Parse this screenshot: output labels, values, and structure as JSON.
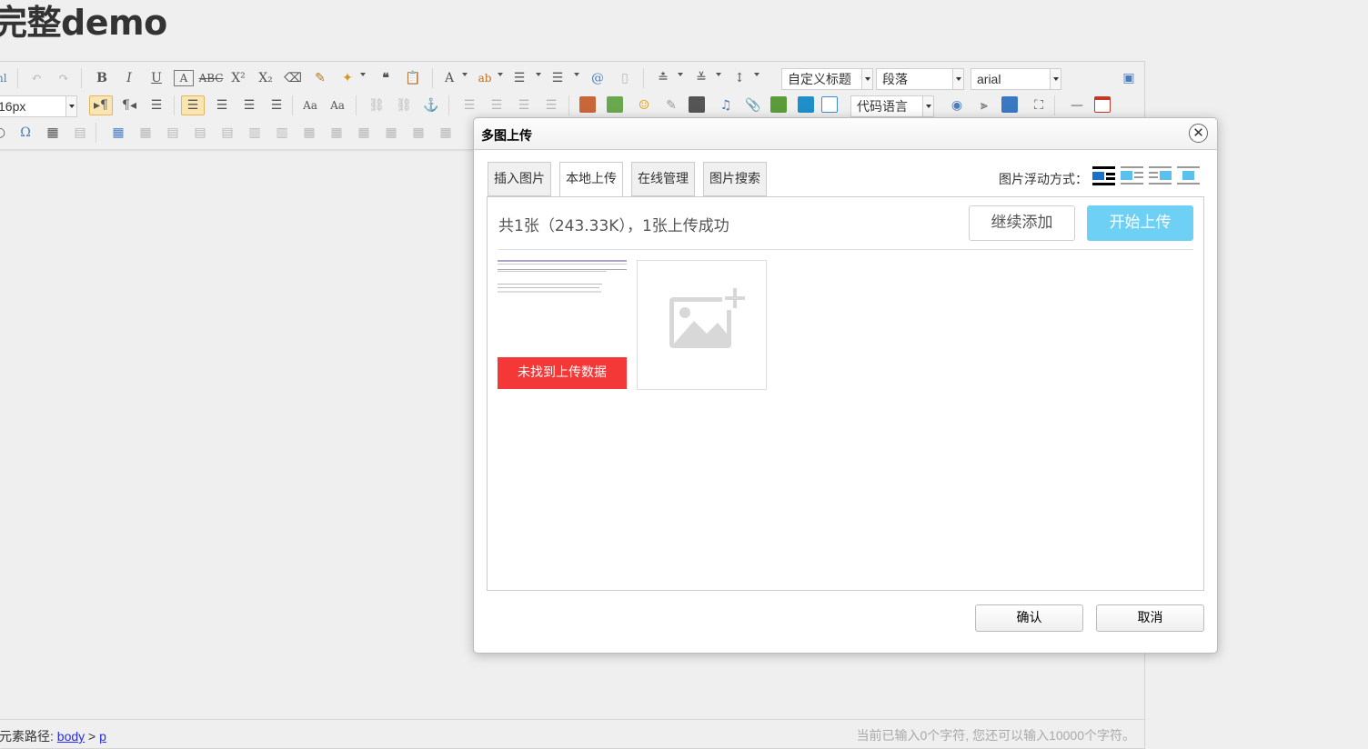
{
  "page": {
    "title": "完整demo"
  },
  "toolbar": {
    "font_size": "16px",
    "custom_heading": "自定义标题",
    "paragraph": "段落",
    "font_family": "arial",
    "code_language": "代码语言"
  },
  "dialog": {
    "title": "多图上传",
    "close": "✕",
    "tabs": [
      "插入图片",
      "本地上传",
      "在线管理",
      "图片搜索"
    ],
    "float_label": "图片浮动方式：",
    "info": "共1张（243.33K），1张上传成功",
    "add_more": "继续添加",
    "start_upload": "开始上传",
    "error": "未找到上传数据",
    "ok": "确认",
    "cancel": "取消"
  },
  "status": {
    "path_label": "元素路径:",
    "path_items": [
      "body",
      "p"
    ],
    "path_sep": ">",
    "count_text": "当前已输入0个字符, 您还可以输入10000个字符。"
  },
  "colors": {
    "accent": "#6fd0f5",
    "error": "#f43838",
    "active_button": "#fbe6b1"
  }
}
